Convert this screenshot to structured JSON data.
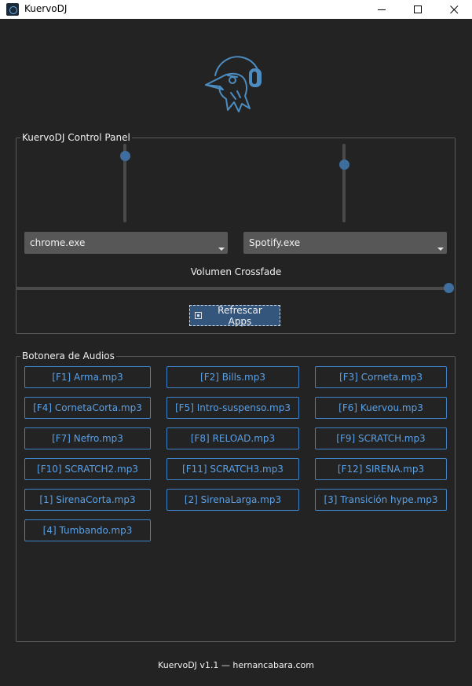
{
  "window": {
    "title": "KuervoDJ"
  },
  "control_panel": {
    "label": "KuervoDJ Control Panel",
    "left_volume_level": 0.9,
    "right_volume_level": 0.77,
    "left_app": "chrome.exe",
    "right_app": "Spotify.exe",
    "crossfade_label": "Volumen Crossfade",
    "crossfade_level": 1.0,
    "refresh_label": "Refrescar Apps"
  },
  "soundboard": {
    "label": "Botonera de Audios",
    "buttons": [
      "[F1] Arma.mp3",
      "[F2] Bills.mp3",
      "[F3] Corneta.mp3",
      "[F4] CornetaCorta.mp3",
      "[F5] Intro-suspenso.mp3",
      "[F6] Kuervou.mp3",
      "[F7] Nefro.mp3",
      "[F8] RELOAD.mp3",
      "[F9] SCRATCH.mp3",
      "[F10] SCRATCH2.mp3",
      "[F11] SCRATCH3.mp3",
      "[F12] SIRENA.mp3",
      "[1] SirenaCorta.mp3",
      "[2] SirenaLarga.mp3",
      "[3] Transición hype.mp3",
      "[4] Tumbando.mp3"
    ]
  },
  "footer": {
    "text": "KuervoDJ v1.1 — hernancabara.com"
  },
  "colors": {
    "accent": "#3d6e9e",
    "button_text": "#5aa0e6",
    "button_border": "#3f82c8",
    "background": "#232323"
  }
}
